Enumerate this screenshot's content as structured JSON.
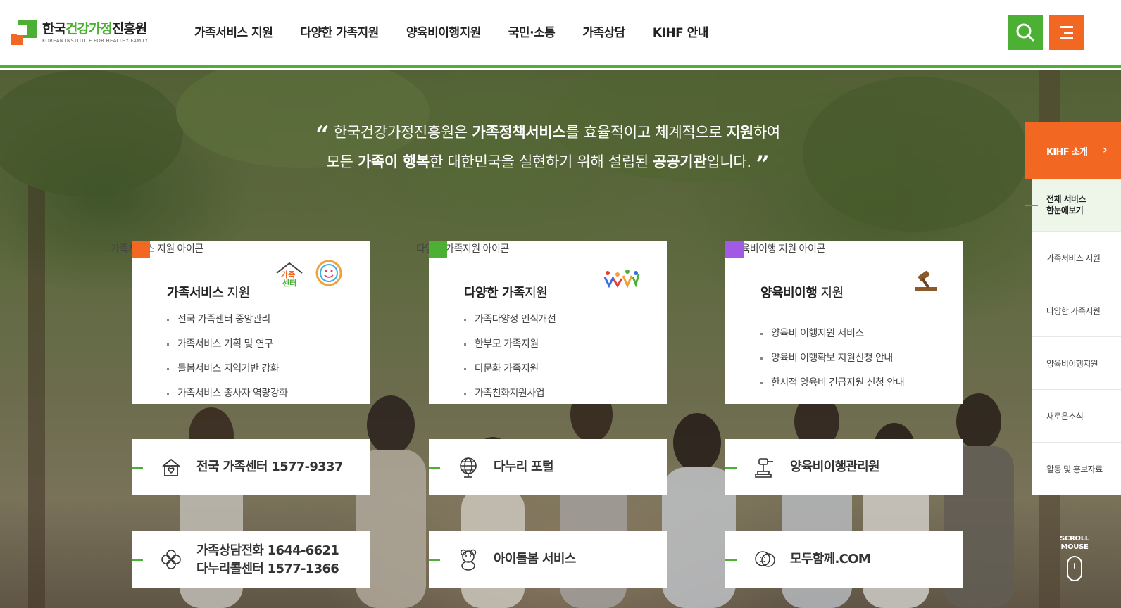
{
  "header": {
    "logo": {
      "name_part1": "한국",
      "name_part2": "건강가정",
      "name_part3": "진흥원",
      "subtitle": "KOREAN INSTITUTE FOR HEALTHY FAMILY"
    },
    "nav": [
      "가족서비스 지원",
      "다양한 가족지원",
      "양육비이행지원",
      "국민·소통",
      "가족상담",
      "KIHF 안내"
    ],
    "search_icon": "search-icon",
    "menu_icon": "hamburger-menu-icon",
    "colors": {
      "green": "#4cb035",
      "orange": "#f26722",
      "purple": "#a259e6"
    }
  },
  "hero": {
    "quote_line1": {
      "a": "한국건강가정진흥원은 ",
      "b": "가족정책서비스",
      "c": "를 효율적이고 체계적으로 ",
      "d": "지원",
      "e": "하여"
    },
    "quote_line2": {
      "a": "모든 ",
      "b": "가족이 행복",
      "c": "한 대한민국을 실현하기 위해 설립된 ",
      "d": "공공기관",
      "e": "입니다."
    },
    "open_quote": "“",
    "close_quote": "”"
  },
  "cards": [
    {
      "alt": "가족서비스 지원 아이콘",
      "title_bold": "가족서비스",
      "title_rest": " 지원",
      "icon": "family-center-icon",
      "icon_text": "가족센터",
      "items": [
        "전국 가족센터 중앙관리",
        "가족서비스 기획 및 연구",
        "돌봄서비스 지역기반 강화",
        "가족서비스 종사자 역량강화"
      ]
    },
    {
      "alt": "다양한 가족지원 아이콘",
      "title_bold": "다양한 가족",
      "title_rest": "지원",
      "icon": "diverse-family-icon",
      "items": [
        "가족다양성 인식개선",
        "한부모 가족지원",
        "다문화 가족지원",
        "가족친화지원사업"
      ]
    },
    {
      "alt": "양육비이행 지원 아이콘",
      "title_bold": "양육비이행",
      "title_rest": " 지원",
      "icon": "gavel-icon",
      "items": [
        "양육비 이행지원 서비스",
        "양육비 이행확보 지원신청 안내",
        "한시적 양육비 긴급지원 신청 안내"
      ]
    }
  ],
  "links": [
    {
      "text": "전국 가족센터 1577-9337",
      "icon": "house-heart-icon"
    },
    {
      "text": "다누리 포털",
      "icon": "globe-icon"
    },
    {
      "text": "양육비이행관리원",
      "icon": "gavel-stand-icon"
    },
    {
      "text_line1": "가족상담전화 1644-6621",
      "text_line2": "다누리콜센터 1577-1366",
      "icon": "clover-icon"
    },
    {
      "text": "아이돌봄 서비스",
      "icon": "teddy-bear-icon"
    },
    {
      "text": "모두함께.COM",
      "icon": "chat-smile-icon"
    }
  ],
  "quick_menu": {
    "head": "KIHF 소개",
    "items": [
      {
        "line1": "전체 서비스",
        "line2": "한눈에보기"
      },
      "가족서비스 지원",
      "다양한 가족지원",
      "양육비이행지원",
      "새로운소식",
      "활동 및 홍보자료"
    ]
  },
  "scroll": {
    "line1": "SCROLL",
    "line2": "MOUSE"
  }
}
